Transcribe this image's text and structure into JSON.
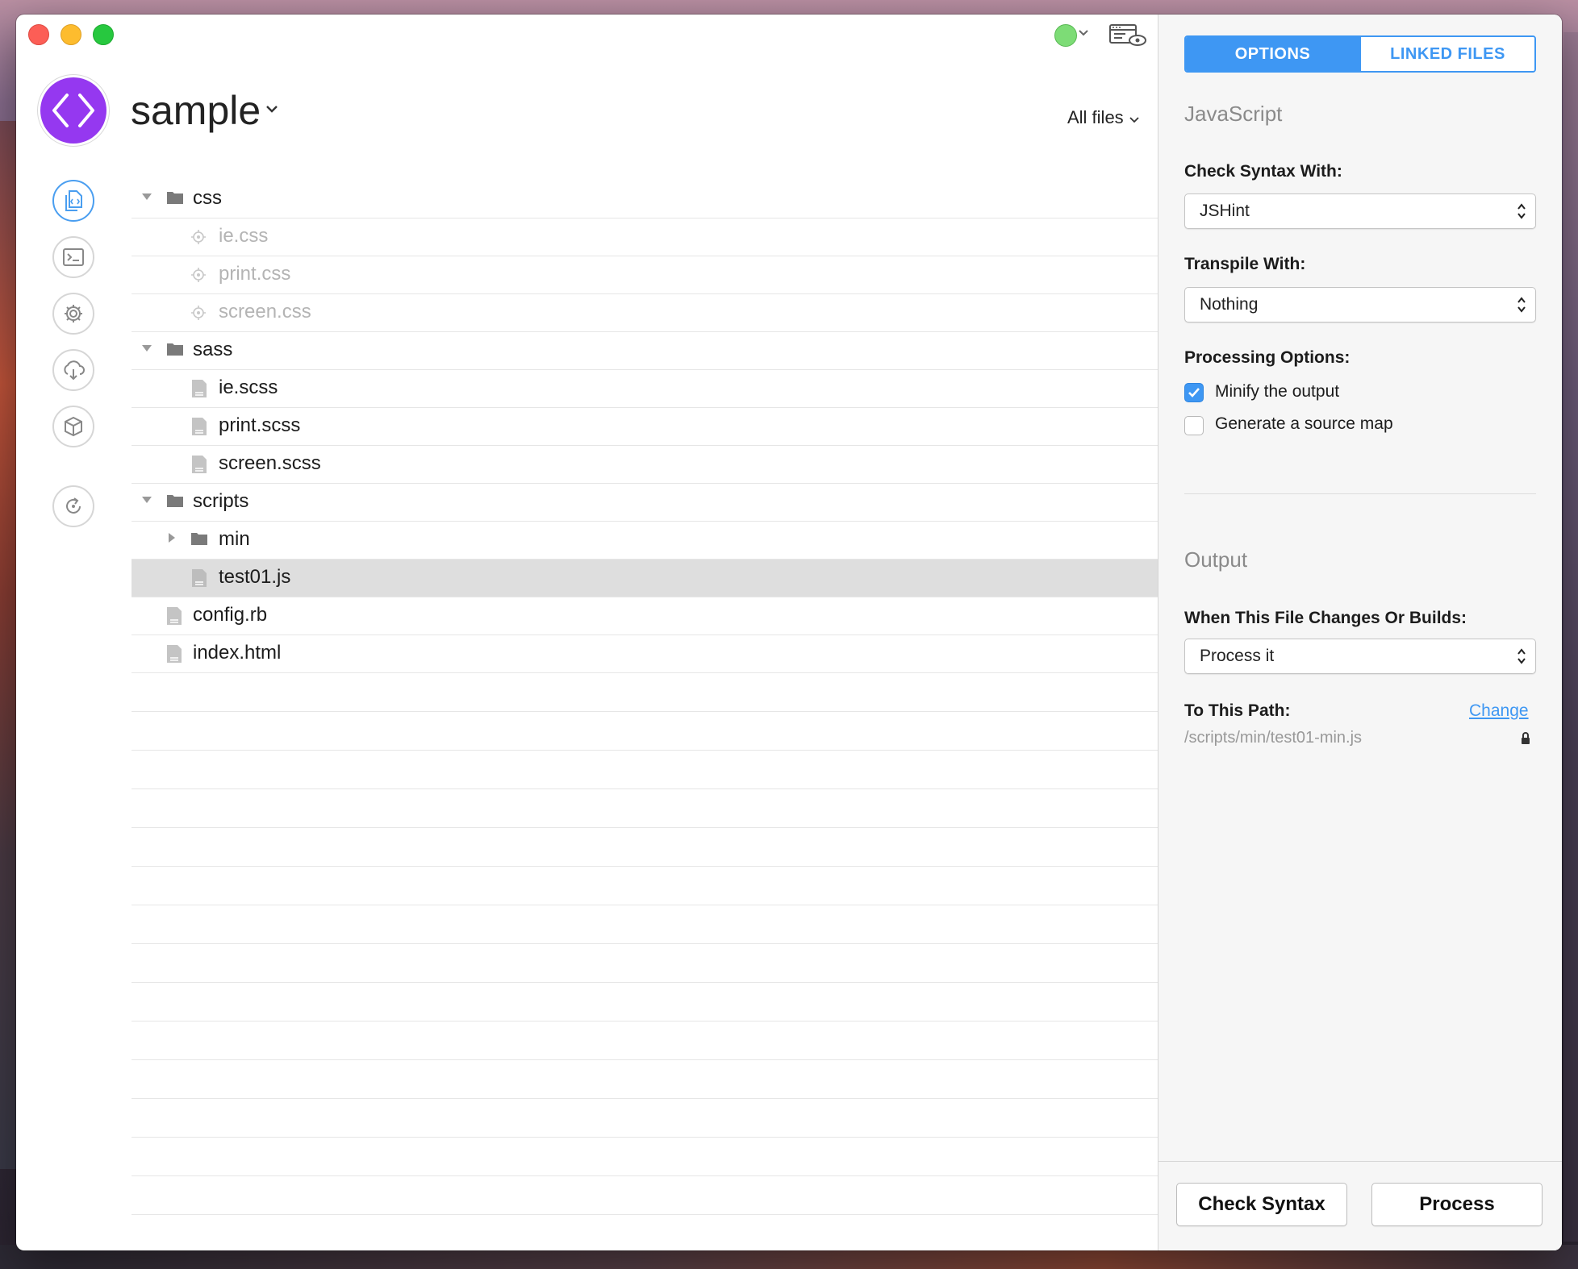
{
  "app": {
    "project_name": "sample",
    "filter_label": "All files"
  },
  "toolbar": {
    "status_icon": "status-dot-icon",
    "status_color": "#7ddc76",
    "preview_icon": "browser-preview-icon"
  },
  "nav": {
    "items": [
      {
        "name": "files",
        "icon": "files-icon",
        "active": true
      },
      {
        "name": "log",
        "icon": "terminal-icon",
        "active": false
      },
      {
        "name": "settings",
        "icon": "gear-icon",
        "active": false
      },
      {
        "name": "cloud",
        "icon": "cloud-download-icon",
        "active": false
      },
      {
        "name": "packages",
        "icon": "box-icon",
        "active": false
      },
      {
        "name": "refresh",
        "icon": "refresh-icon",
        "active": false
      }
    ],
    "accent_color": "#9538f0"
  },
  "files": [
    {
      "label": "css",
      "type": "folder",
      "depth": 0,
      "expanded": true
    },
    {
      "label": "ie.css",
      "type": "target",
      "depth": 1,
      "dim": true
    },
    {
      "label": "print.css",
      "type": "target",
      "depth": 1,
      "dim": true
    },
    {
      "label": "screen.css",
      "type": "target",
      "depth": 1,
      "dim": true
    },
    {
      "label": "sass",
      "type": "folder",
      "depth": 0,
      "expanded": true
    },
    {
      "label": "ie.scss",
      "type": "file",
      "depth": 1
    },
    {
      "label": "print.scss",
      "type": "file",
      "depth": 1
    },
    {
      "label": "screen.scss",
      "type": "file",
      "depth": 1
    },
    {
      "label": "scripts",
      "type": "folder",
      "depth": 0,
      "expanded": true
    },
    {
      "label": "min",
      "type": "folder",
      "depth": 1,
      "expanded": false
    },
    {
      "label": "test01.js",
      "type": "file",
      "depth": 1,
      "selected": true
    },
    {
      "label": "config.rb",
      "type": "file",
      "depth": 0
    },
    {
      "label": "index.html",
      "type": "file",
      "depth": 0
    }
  ],
  "panel": {
    "tabs": {
      "options": "OPTIONS",
      "linked": "LINKED FILES"
    },
    "language": "JavaScript",
    "check_syntax_label": "Check Syntax With:",
    "check_syntax_value": "JSHint",
    "transpile_label": "Transpile With:",
    "transpile_value": "Nothing",
    "processing_label": "Processing Options:",
    "minify_label": "Minify the output",
    "minify_checked": true,
    "sourcemap_label": "Generate a source map",
    "sourcemap_checked": false,
    "output_heading": "Output",
    "when_label": "When This File Changes Or Builds:",
    "when_value": "Process it",
    "path_label": "To This Path:",
    "change_link": "Change",
    "output_path": "/scripts/min/test01-min.js",
    "check_syntax_button": "Check Syntax",
    "process_button": "Process",
    "accent_color": "#3e97f3"
  }
}
